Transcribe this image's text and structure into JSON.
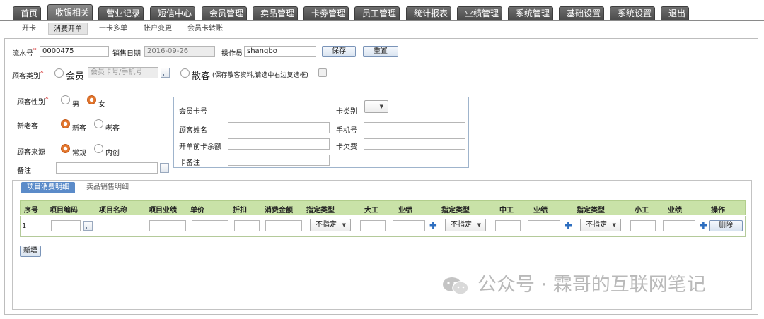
{
  "top_tabs": [
    "首页",
    "收银相关",
    "营业记录",
    "短信中心",
    "会员管理",
    "卖品管理",
    "卡劵管理",
    "员工管理",
    "统计报表",
    "业绩管理",
    "系统管理",
    "基础设置",
    "系统设置",
    "退出"
  ],
  "sub_tabs": [
    "开卡",
    "消费开单",
    "一卡多单",
    "帐户变更",
    "会员卡转账"
  ],
  "form": {
    "serial_label": "流水号",
    "serial_value": "0000475",
    "date_label": "销售日期",
    "date_value": "2016-09-26",
    "operator_label": "操作员",
    "operator_value": "shangbo",
    "save_label": "保存",
    "reset_label": "重置",
    "customer_type_label": "顾客类别",
    "member_label": "会员",
    "member_placeholder": "会员卡号/手机号",
    "walkin_label": "散客",
    "walkin_note": "(保存散客资料,请选中右边复选框)",
    "gender_label": "顾客性别",
    "male_label": "男",
    "female_label": "女",
    "newold_label": "新老客",
    "new_label": "新客",
    "old_label": "老客",
    "source_label": "顾客来源",
    "regular_label": "常规",
    "internal_label": "内创",
    "remark_label": "备注",
    "required_mark": "*"
  },
  "card": {
    "card_no_label": "会员卡号",
    "card_type_label": "卡类别",
    "name_label": "顾客姓名",
    "phone_label": "手机号",
    "balance_label": "开单前卡余额",
    "debt_label": "卡欠费",
    "card_remark_label": "卡备注"
  },
  "detail": {
    "tab_active": "项目消费明细",
    "tab_other": "卖品销售明细",
    "columns": [
      "序号",
      "项目编码",
      "项目名称",
      "项目业绩",
      "单价",
      "折扣",
      "消费金额",
      "指定类型",
      "大工",
      "业绩",
      "指定类型",
      "中工",
      "业绩",
      "指定类型",
      "小工",
      "业绩",
      "操作"
    ],
    "row_index": "1",
    "select_value": "不指定",
    "delete_label": "删除",
    "add_label": "新增"
  },
  "watermark": {
    "text": "公众号 · 霖哥的互联网笔记",
    "icon": "wechat-icon"
  },
  "colors": {
    "tab_bg": "#5a5a5a",
    "table_header": "#c9e2a8",
    "active_detail_tab": "#5b8bc9",
    "radio_selected": "#e2752c"
  }
}
